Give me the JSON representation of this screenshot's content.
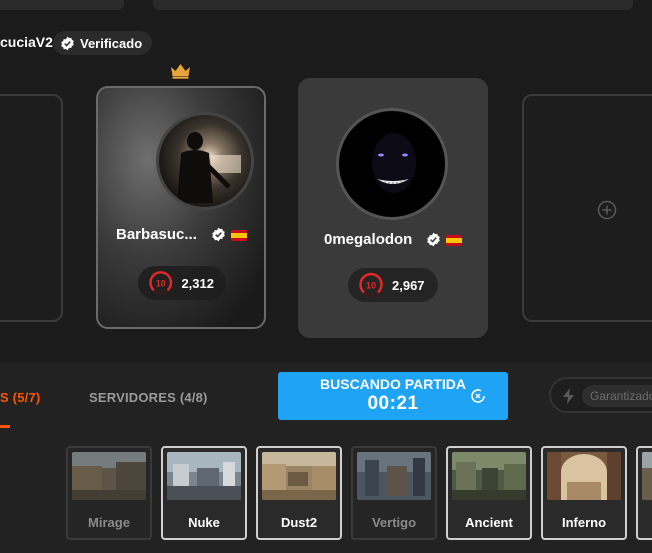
{
  "profile": {
    "username": "cuciaV2",
    "verified_label": "Verificado"
  },
  "players": [
    {
      "name": "Barbasuc...",
      "elo": "2,312",
      "level": "10",
      "leader": true
    },
    {
      "name": "0megalodon",
      "elo": "2,967",
      "level": "10",
      "leader": false
    }
  ],
  "tabs": {
    "maps": "S (5/7)",
    "servers": "SERVIDORES (4/8)"
  },
  "search": {
    "title": "BUSCANDO PARTIDA",
    "timer": "00:21"
  },
  "guarantee": {
    "placeholder": "Garantizado"
  },
  "maps": [
    {
      "name": "Mirage",
      "enabled": false
    },
    {
      "name": "Nuke",
      "enabled": true
    },
    {
      "name": "Dust2",
      "enabled": true
    },
    {
      "name": "Vertigo",
      "enabled": false
    },
    {
      "name": "Ancient",
      "enabled": true
    },
    {
      "name": "Inferno",
      "enabled": true
    }
  ],
  "colors": {
    "accent_orange": "#ff5500",
    "search_blue": "#1fa3f5",
    "level_red": "#e02a2a"
  }
}
